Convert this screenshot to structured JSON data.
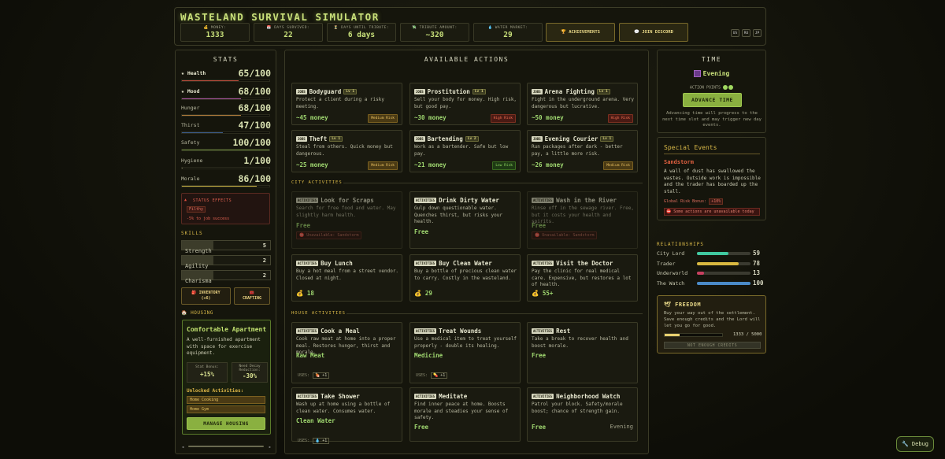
{
  "header": {
    "title": "WASTELAND SURVIVAL SIMULATOR",
    "stats": [
      {
        "icon": "money-bag-icon",
        "glyph": "💰",
        "label": "MONEY:",
        "value": "1333"
      },
      {
        "icon": "calendar-icon",
        "glyph": "📅",
        "label": "DAYS SURVIVED:",
        "value": "22"
      },
      {
        "icon": "hourglass-icon",
        "glyph": "⏳",
        "label": "DAYS UNTIL TRIBUTE:",
        "value": "6 days"
      },
      {
        "icon": "tribute-icon",
        "glyph": "💸",
        "label": "TRIBUTE AMOUNT:",
        "value": "~320"
      },
      {
        "icon": "water-drop-icon",
        "glyph": "💧",
        "label": "WATER MARKET:",
        "value": "29"
      }
    ],
    "achievements_label": "ACHIEVEMENTS",
    "discord_label": "JOIN DISCORD",
    "languages": [
      "US",
      "RU",
      "JP"
    ]
  },
  "stats_panel": {
    "title": "STATS",
    "bars": [
      {
        "label": "Health",
        "value": "65/100",
        "pct": 65,
        "color": "#b84a3a",
        "star": true
      },
      {
        "label": "Mood",
        "value": "68/100",
        "pct": 68,
        "color": "#a850a0",
        "star": true
      },
      {
        "label": "Hunger",
        "value": "68/100",
        "pct": 68,
        "color": "#b07a3a"
      },
      {
        "label": "Thirst",
        "value": "47/100",
        "pct": 47,
        "color": "#3a5a8a"
      },
      {
        "label": "Safety",
        "value": "100/100",
        "pct": 100,
        "color": "#6a8a3a"
      },
      {
        "label": "Hygiene",
        "value": "1/100",
        "pct": 1,
        "color": "#6a6a50"
      },
      {
        "label": "Morale",
        "value": "86/100",
        "pct": 86,
        "color": "#c8b040"
      }
    ],
    "status_effects_title": "STATUS EFFECTS",
    "status_tag": "Filthy",
    "status_effect": "-5% to job success",
    "skills_title": "SKILLS",
    "skills": [
      {
        "label": "Strength",
        "value": "5"
      },
      {
        "label": "Agility",
        "value": "2"
      },
      {
        "label": "Charisma",
        "value": "2"
      }
    ],
    "inventory_label": "INVENTORY",
    "inventory_count": "(+6)",
    "crafting_label": "CRAFTING",
    "housing_title": "HOUSING",
    "housing_name": "Comfortable Apartment",
    "housing_desc": "A well-furnished apartment with space for exercise equipment.",
    "stat_bonus_label": "Stat Bonus:",
    "stat_bonus_value": "+15%",
    "decay_label": "Need Decay Reduction:",
    "decay_value": "-30%",
    "unlocked_title": "Unlocked Activities:",
    "unlocked": [
      "Home Cooking",
      "Home Gym"
    ],
    "manage_label": "MANAGE HOUSING"
  },
  "actions": {
    "title": "AVAILABLE ACTIONS",
    "jobs": [
      {
        "tag": "JOBS",
        "name": "Bodyguard",
        "lv": "Lv 1",
        "desc": "Protect a client during a risky meeting.",
        "reward": "~45 money",
        "risk": "Medium Risk",
        "rk": "m"
      },
      {
        "tag": "JOBS",
        "name": "Prostitution",
        "lv": "Lv 1",
        "desc": "Sell your body for money. High risk, but good pay.",
        "reward": "~30 money",
        "risk": "High Risk",
        "rk": "h"
      },
      {
        "tag": "JOBS",
        "name": "Arena Fighting",
        "lv": "Lv 1",
        "desc": "Fight in the underground arena. Very dangerous but lucrative.",
        "reward": "~50 money",
        "risk": "High Risk",
        "rk": "h"
      },
      {
        "tag": "JOBS",
        "name": "Theft",
        "lv": "Lv 1",
        "desc": "Steal from others. Quick money but dangerous.",
        "reward": "~25 money",
        "risk": "Medium Risk",
        "rk": "m"
      },
      {
        "tag": "JOBS",
        "name": "Bartending",
        "lv": "Lv 2",
        "desc": "Work as a bartender. Safe but low pay.",
        "reward": "~21 money",
        "risk": "Low Risk",
        "rk": "lo"
      },
      {
        "tag": "JOBS",
        "name": "Evening Courier",
        "lv": "Lv 1",
        "desc": "Run packages after dark - better pay, a little more risk.",
        "reward": "~26 money",
        "risk": "Medium Risk",
        "rk": "m"
      }
    ],
    "city_title": "CITY ACTIVITIES",
    "city": [
      {
        "tag": "ACTIVITIES",
        "name": "Look for Scraps",
        "desc": "Search for free food and water. May slightly harm health.",
        "reward": "Free",
        "unavailable": "Unavailable: Sandstorm",
        "dim": true
      },
      {
        "tag": "ACTIVITIES",
        "name": "Drink Dirty Water",
        "desc": "Gulp down questionable water. Quenches thirst, but risks your health.",
        "reward": "Free"
      },
      {
        "tag": "ACTIVITIES",
        "name": "Wash in the River",
        "desc": "Rinse off in the sewage river. Free, but it costs your health and spirits.",
        "reward": "Free",
        "unavailable": "Unavailable: Sandstorm",
        "dim": true
      },
      {
        "tag": "ACTIVITIES",
        "name": "Buy Lunch",
        "desc": "Buy a hot meal from a street vendor. Closed at night.",
        "reward": "18",
        "coin": true
      },
      {
        "tag": "ACTIVITIES",
        "name": "Buy Clean Water",
        "desc": "Buy a bottle of precious clean water to carry. Costly in the wasteland.",
        "reward": "29",
        "coin": true
      },
      {
        "tag": "ACTIVITIES",
        "name": "Visit the Doctor",
        "desc": "Pay the clinic for real medical care. Expensive, but restores a lot of health.",
        "reward": "55+",
        "coin": true
      }
    ],
    "house_title": "HOUSE ACTIVITIES",
    "house": [
      {
        "tag": "ACTIVITIES",
        "name": "Cook a Meal",
        "desc": "Cook raw meat at home into a proper meal. Restores hunger, thirst and morale.",
        "reward": "Raw Meat",
        "uses_label": "USES:",
        "uses": "🍖 +1"
      },
      {
        "tag": "ACTIVITIES",
        "name": "Treat Wounds",
        "desc": "Use a medical item to treat yourself properly - double its healing.",
        "reward": "Medicine",
        "uses_label": "USES:",
        "uses": "💊 +1"
      },
      {
        "tag": "ACTIVITIES",
        "name": "Rest",
        "desc": "Take a break to recover health and boost morale.",
        "reward": "Free"
      },
      {
        "tag": "ACTIVITIES",
        "name": "Take Shower",
        "desc": "Wash up at home using a bottle of clean water. Consumes water.",
        "reward": "Clean Water",
        "uses_label": "USES:",
        "uses": "💧 +1"
      },
      {
        "tag": "ACTIVITIES",
        "name": "Meditate",
        "desc": "Find inner peace at home. Boosts morale and steadies your sense of safety.",
        "reward": "Free"
      },
      {
        "tag": "ACTIVITIES",
        "name": "Neighborhood Watch",
        "desc": "Patrol your block. Safety/morale boost; chance of strength gain.",
        "reward": "Free",
        "time": "Evening"
      }
    ]
  },
  "time_panel": {
    "title": "TIME",
    "period": "Evening",
    "action_points_label": "ACTION POINTS",
    "advance_label": "ADVANCE TIME",
    "advance_desc": "Advancing time will progress to the next time slot and may trigger new day events."
  },
  "events": {
    "title": "Special Events",
    "name": "Sandstorm",
    "desc": "A wall of dust has swallowed the wastes. Outside work is impossible and the trader has boarded up the stall.",
    "risk_label": "Global Risk Bonus:",
    "risk_value": "+10%",
    "warning": "Some actions are unavailable today"
  },
  "relationships": {
    "title": "RELATIONSHIPS",
    "items": [
      {
        "name": "City Lord",
        "value": "59",
        "pct": 59,
        "color": "#40c8a0"
      },
      {
        "name": "Trader",
        "value": "78",
        "pct": 78,
        "color": "#d8b840"
      },
      {
        "name": "Underworld",
        "value": "13",
        "pct": 13,
        "color": "#c84060"
      },
      {
        "name": "The Watch",
        "value": "100",
        "pct": 100,
        "color": "#4a8ac8"
      }
    ]
  },
  "freedom": {
    "title": "FREEDOM",
    "desc": "Buy your way out of the settlement. Save enough credits and the Lord will let you go for good.",
    "progress": "1333 / 5000",
    "pct": 26.66,
    "button": "NOT ENOUGH CREDITS"
  },
  "debug_label": "Debug"
}
